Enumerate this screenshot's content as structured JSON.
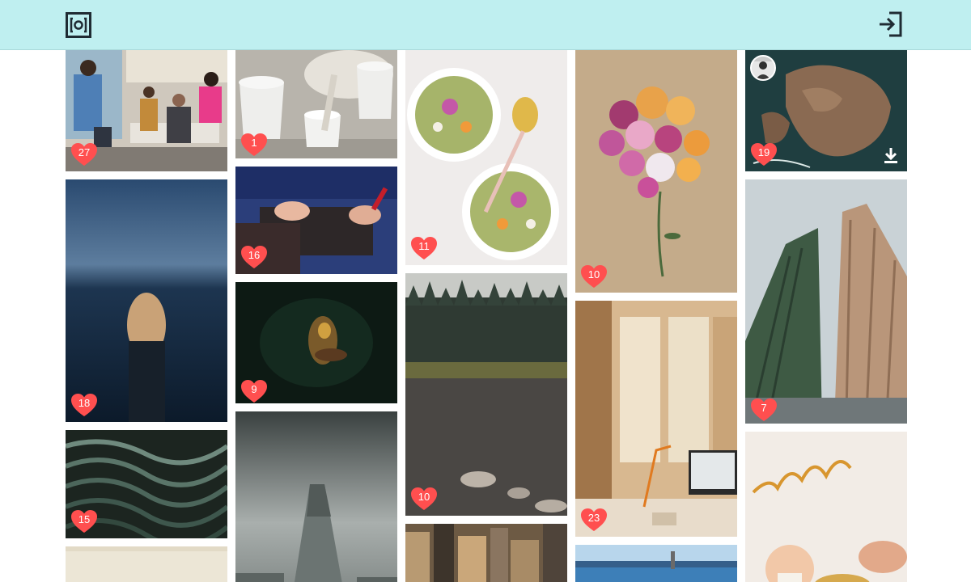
{
  "header": {
    "logo_icon": "camera-frame-logo-icon",
    "login_icon": "sign-in-icon",
    "background": "#bfeff0"
  },
  "gallery": {
    "heart_color": "#ff4f4f",
    "tiles": [
      {
        "name": "photo-team-meeting",
        "likes": "27"
      },
      {
        "name": "photo-woman-in-sea",
        "likes": "18"
      },
      {
        "name": "photo-abstract-waves",
        "likes": "15"
      },
      {
        "name": "photo-wall-bottom"
      },
      {
        "name": "photo-singing-bowls",
        "likes": "1"
      },
      {
        "name": "photo-hands-device",
        "likes": "16"
      },
      {
        "name": "photo-underwater-diver",
        "likes": "9"
      },
      {
        "name": "photo-tower-building"
      },
      {
        "name": "photo-green-soup",
        "likes": "11"
      },
      {
        "name": "photo-forest-lake",
        "likes": "10"
      },
      {
        "name": "photo-city-skyline"
      },
      {
        "name": "photo-flower-bouquet",
        "likes": "10"
      },
      {
        "name": "photo-office-desk",
        "likes": "23"
      },
      {
        "name": "photo-beach-pier"
      },
      {
        "name": "photo-island-aerial",
        "likes": "19"
      },
      {
        "name": "photo-twin-towers",
        "likes": "7"
      },
      {
        "name": "photo-birthday-baby"
      }
    ]
  }
}
